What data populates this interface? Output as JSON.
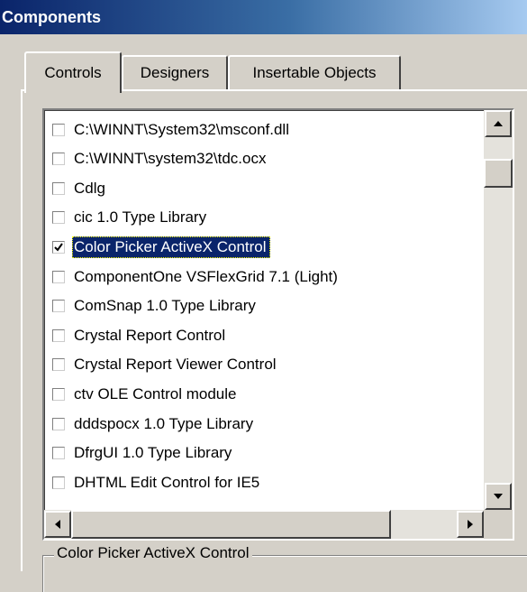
{
  "window": {
    "title": "Components"
  },
  "tabs": [
    {
      "label": "Controls",
      "active": true
    },
    {
      "label": "Designers",
      "active": false
    },
    {
      "label": "Insertable Objects",
      "active": false
    }
  ],
  "list": {
    "items": [
      {
        "label": "C:\\WINNT\\System32\\msconf.dll",
        "checked": false,
        "selected": false
      },
      {
        "label": "C:\\WINNT\\system32\\tdc.ocx",
        "checked": false,
        "selected": false
      },
      {
        "label": "Cdlg",
        "checked": false,
        "selected": false
      },
      {
        "label": "cic 1.0 Type Library",
        "checked": false,
        "selected": false
      },
      {
        "label": "Color Picker ActiveX Control",
        "checked": true,
        "selected": true
      },
      {
        "label": "ComponentOne VSFlexGrid 7.1 (Light)",
        "checked": false,
        "selected": false
      },
      {
        "label": "ComSnap 1.0 Type Library",
        "checked": false,
        "selected": false
      },
      {
        "label": "Crystal Report Control",
        "checked": false,
        "selected": false
      },
      {
        "label": "Crystal Report Viewer Control",
        "checked": false,
        "selected": false
      },
      {
        "label": "ctv OLE Control module",
        "checked": false,
        "selected": false
      },
      {
        "label": "dddspocx 1.0 Type Library",
        "checked": false,
        "selected": false
      },
      {
        "label": "DfrgUI 1.0 Type Library",
        "checked": false,
        "selected": false
      },
      {
        "label": "DHTML Edit Control for IE5",
        "checked": false,
        "selected": false
      }
    ]
  },
  "details": {
    "group_label": "Color Picker ActiveX Control"
  },
  "icons": {
    "scroll_up": "arrow-up-icon",
    "scroll_down": "arrow-down-icon",
    "scroll_left": "arrow-left-icon",
    "scroll_right": "arrow-right-icon",
    "check": "checkmark-icon"
  },
  "colors": {
    "face": "#d4d0c8",
    "selection": "#0a246a",
    "title_start": "#0a246a",
    "title_end": "#a6caf0"
  }
}
